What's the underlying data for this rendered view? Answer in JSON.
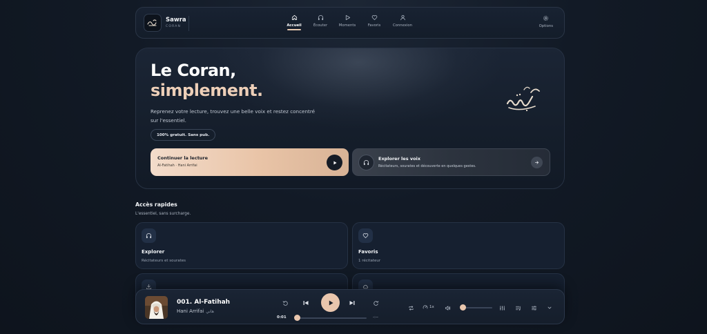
{
  "nav": {
    "brand_name": "Sawra",
    "brand_sub": "CORAN",
    "items": [
      {
        "label": "Accueil",
        "icon": "home-icon",
        "active": true
      },
      {
        "label": "Écouter",
        "icon": "headphones-icon"
      },
      {
        "label": "Moments",
        "icon": "play-icon"
      },
      {
        "label": "Favoris",
        "icon": "heart-icon"
      },
      {
        "label": "Connexion",
        "icon": "user-icon"
      }
    ],
    "options_label": "Options"
  },
  "hero": {
    "title_line1": "Le Coran,",
    "title_line2": "simplement.",
    "description": "Reprenez votre lecture, trouvez une belle voix et restez concentré sur l'essentiel.",
    "badge": "100% gratuit. Sans pub.",
    "continue_card": {
      "title": "Continuer la lecture",
      "subtitle": "Al-Fatihah · Hani Arrifai"
    },
    "voices_card": {
      "title": "Explorer les voix",
      "subtitle": "Récitateurs, sourates et découverte en quelques gestes."
    }
  },
  "quick_access": {
    "title": "Accès rapides",
    "subtitle": "L'essentiel, sans surcharge.",
    "cards": [
      {
        "title": "Explorer",
        "subtitle": "Récitateurs et sourates",
        "icon": "headphones-icon"
      },
      {
        "title": "Favoris",
        "subtitle": "1 récitateur",
        "icon": "heart-icon"
      },
      {
        "title": "",
        "subtitle": "",
        "icon": "download-icon"
      },
      {
        "title": "",
        "subtitle": "",
        "icon": "cloud-icon"
      }
    ]
  },
  "player": {
    "track_title": "001. Al-Fatihah",
    "artist": "Hani Arrifai",
    "artist_arabic": "هاني",
    "time_current": "0:01",
    "time_end": "-:--",
    "progress": 0.0,
    "speed": "1x",
    "volume": 0.0
  },
  "colors": {
    "accent": "#e9c6ad",
    "background": "#121a26",
    "card": "#162030"
  }
}
